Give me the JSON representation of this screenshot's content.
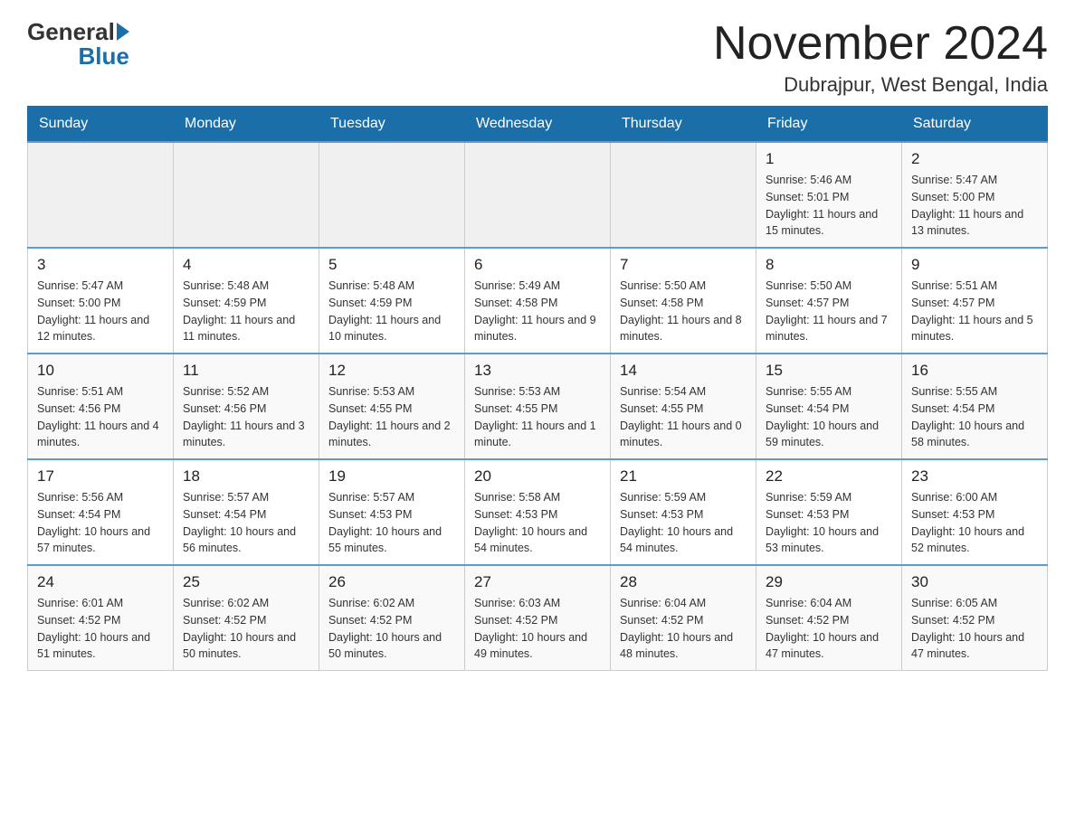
{
  "header": {
    "logo_general": "General",
    "logo_blue": "Blue",
    "month_title": "November 2024",
    "location": "Dubrajpur, West Bengal, India"
  },
  "days_of_week": [
    "Sunday",
    "Monday",
    "Tuesday",
    "Wednesday",
    "Thursday",
    "Friday",
    "Saturday"
  ],
  "weeks": [
    {
      "days": [
        {
          "date": "",
          "info": ""
        },
        {
          "date": "",
          "info": ""
        },
        {
          "date": "",
          "info": ""
        },
        {
          "date": "",
          "info": ""
        },
        {
          "date": "",
          "info": ""
        },
        {
          "date": "1",
          "info": "Sunrise: 5:46 AM\nSunset: 5:01 PM\nDaylight: 11 hours and 15 minutes."
        },
        {
          "date": "2",
          "info": "Sunrise: 5:47 AM\nSunset: 5:00 PM\nDaylight: 11 hours and 13 minutes."
        }
      ]
    },
    {
      "days": [
        {
          "date": "3",
          "info": "Sunrise: 5:47 AM\nSunset: 5:00 PM\nDaylight: 11 hours and 12 minutes."
        },
        {
          "date": "4",
          "info": "Sunrise: 5:48 AM\nSunset: 4:59 PM\nDaylight: 11 hours and 11 minutes."
        },
        {
          "date": "5",
          "info": "Sunrise: 5:48 AM\nSunset: 4:59 PM\nDaylight: 11 hours and 10 minutes."
        },
        {
          "date": "6",
          "info": "Sunrise: 5:49 AM\nSunset: 4:58 PM\nDaylight: 11 hours and 9 minutes."
        },
        {
          "date": "7",
          "info": "Sunrise: 5:50 AM\nSunset: 4:58 PM\nDaylight: 11 hours and 8 minutes."
        },
        {
          "date": "8",
          "info": "Sunrise: 5:50 AM\nSunset: 4:57 PM\nDaylight: 11 hours and 7 minutes."
        },
        {
          "date": "9",
          "info": "Sunrise: 5:51 AM\nSunset: 4:57 PM\nDaylight: 11 hours and 5 minutes."
        }
      ]
    },
    {
      "days": [
        {
          "date": "10",
          "info": "Sunrise: 5:51 AM\nSunset: 4:56 PM\nDaylight: 11 hours and 4 minutes."
        },
        {
          "date": "11",
          "info": "Sunrise: 5:52 AM\nSunset: 4:56 PM\nDaylight: 11 hours and 3 minutes."
        },
        {
          "date": "12",
          "info": "Sunrise: 5:53 AM\nSunset: 4:55 PM\nDaylight: 11 hours and 2 minutes."
        },
        {
          "date": "13",
          "info": "Sunrise: 5:53 AM\nSunset: 4:55 PM\nDaylight: 11 hours and 1 minute."
        },
        {
          "date": "14",
          "info": "Sunrise: 5:54 AM\nSunset: 4:55 PM\nDaylight: 11 hours and 0 minutes."
        },
        {
          "date": "15",
          "info": "Sunrise: 5:55 AM\nSunset: 4:54 PM\nDaylight: 10 hours and 59 minutes."
        },
        {
          "date": "16",
          "info": "Sunrise: 5:55 AM\nSunset: 4:54 PM\nDaylight: 10 hours and 58 minutes."
        }
      ]
    },
    {
      "days": [
        {
          "date": "17",
          "info": "Sunrise: 5:56 AM\nSunset: 4:54 PM\nDaylight: 10 hours and 57 minutes."
        },
        {
          "date": "18",
          "info": "Sunrise: 5:57 AM\nSunset: 4:54 PM\nDaylight: 10 hours and 56 minutes."
        },
        {
          "date": "19",
          "info": "Sunrise: 5:57 AM\nSunset: 4:53 PM\nDaylight: 10 hours and 55 minutes."
        },
        {
          "date": "20",
          "info": "Sunrise: 5:58 AM\nSunset: 4:53 PM\nDaylight: 10 hours and 54 minutes."
        },
        {
          "date": "21",
          "info": "Sunrise: 5:59 AM\nSunset: 4:53 PM\nDaylight: 10 hours and 54 minutes."
        },
        {
          "date": "22",
          "info": "Sunrise: 5:59 AM\nSunset: 4:53 PM\nDaylight: 10 hours and 53 minutes."
        },
        {
          "date": "23",
          "info": "Sunrise: 6:00 AM\nSunset: 4:53 PM\nDaylight: 10 hours and 52 minutes."
        }
      ]
    },
    {
      "days": [
        {
          "date": "24",
          "info": "Sunrise: 6:01 AM\nSunset: 4:52 PM\nDaylight: 10 hours and 51 minutes."
        },
        {
          "date": "25",
          "info": "Sunrise: 6:02 AM\nSunset: 4:52 PM\nDaylight: 10 hours and 50 minutes."
        },
        {
          "date": "26",
          "info": "Sunrise: 6:02 AM\nSunset: 4:52 PM\nDaylight: 10 hours and 50 minutes."
        },
        {
          "date": "27",
          "info": "Sunrise: 6:03 AM\nSunset: 4:52 PM\nDaylight: 10 hours and 49 minutes."
        },
        {
          "date": "28",
          "info": "Sunrise: 6:04 AM\nSunset: 4:52 PM\nDaylight: 10 hours and 48 minutes."
        },
        {
          "date": "29",
          "info": "Sunrise: 6:04 AM\nSunset: 4:52 PM\nDaylight: 10 hours and 47 minutes."
        },
        {
          "date": "30",
          "info": "Sunrise: 6:05 AM\nSunset: 4:52 PM\nDaylight: 10 hours and 47 minutes."
        }
      ]
    }
  ]
}
